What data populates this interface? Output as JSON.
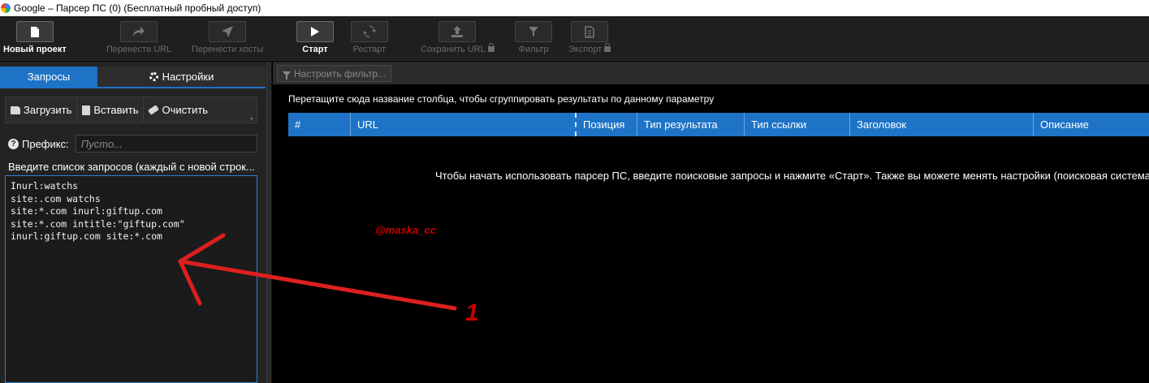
{
  "window": {
    "title": "Google – Парсер ПС (0) (Бесплатный пробный доступ)"
  },
  "toolbar": {
    "buttons": [
      {
        "label": "Новый проект",
        "icon": "new-document-icon",
        "enabled": true
      },
      {
        "label": "Перенести URL",
        "icon": "share-arrow-icon",
        "enabled": false
      },
      {
        "label": "Перенести хосты",
        "icon": "send-icon",
        "enabled": false
      },
      {
        "label": "Старт",
        "icon": "play-icon",
        "enabled": true
      },
      {
        "label": "Рестарт",
        "icon": "refresh-icon",
        "enabled": false
      },
      {
        "label": "Сохранить URL",
        "icon": "upload-icon",
        "enabled": false,
        "locked": true
      },
      {
        "label": "Фильтр",
        "icon": "filter-icon",
        "enabled": false
      },
      {
        "label": "Экспорт",
        "icon": "export-file-icon",
        "enabled": false,
        "locked": true
      }
    ]
  },
  "left": {
    "tabs": [
      {
        "label": "Запросы",
        "active": true
      },
      {
        "label": "Настройки",
        "icon": "gear-icon",
        "active": false
      }
    ],
    "actions": {
      "load": "Загрузить",
      "paste": "Вставить",
      "clear": "Очистить"
    },
    "prefix": {
      "label": "Префикс:",
      "placeholder": "Пусто..."
    },
    "queries_label": "Введите список запросов (каждый с новой строк...",
    "queries": [
      "Inurl:watchs",
      "site:.com watchs",
      "site:*.com inurl:giftup.com",
      "site:*.com intitle:\"giftup.com\"",
      "inurl:giftup.com site:*.com"
    ]
  },
  "right": {
    "filter_button": "Настроить фильтр...",
    "group_hint": "Перетащите сюда название столбца, чтобы сгруппировать результаты по данному параметру",
    "columns": [
      "#",
      "URL",
      "Позиция",
      "Тип результата",
      "Тип ссылки",
      "Заголовок",
      "Описание"
    ],
    "empty_message": "Чтобы начать использовать парсер ПС, введите поисковые запросы и нажмите «Старт». Также вы можете менять настройки (поисковая система, к"
  },
  "annotation": {
    "watermark": "@maska_cc",
    "number": "1",
    "color": "#c80000"
  },
  "colors": {
    "accent": "#1e73c7",
    "panel": "#232323",
    "toolbar": "#1f1f1f"
  }
}
